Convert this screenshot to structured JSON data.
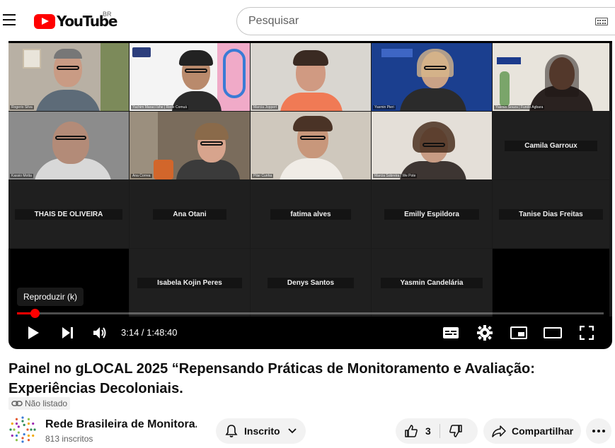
{
  "header": {
    "logo_text": "YouTube",
    "country_code": "BR",
    "search_placeholder": "Pesquisar"
  },
  "player": {
    "tooltip": "Reproduzir (k)",
    "time_current": "3:14",
    "time_total": "1:48:40",
    "time_display": "3:14 / 1:48:40",
    "progress_fraction": 0.0298,
    "video_tiles": [
      {
        "caption": "Rogerio Silva"
      },
      {
        "caption": "Yachim Maraci Ishe | Rede Comuá"
      },
      {
        "caption": "Marcia Joppert"
      },
      {
        "caption": "Yasmin Pieri"
      },
      {
        "caption": "Yasmin Souza | Fundo Agbara"
      },
      {
        "caption": "Kassio Motta"
      },
      {
        "caption": "Ana Correa"
      },
      {
        "caption": "Pilar Cunha"
      },
      {
        "caption": "Marcia Sobreira | We Pote"
      }
    ],
    "name_tiles": [
      "Camila Garroux",
      "THAIS DE OLIVEIRA",
      "Ana Otani",
      "fatima alves",
      "Emilly Espildora",
      "Tanise Dias Freitas",
      "Isabela Kojin Peres",
      "Denys Santos",
      "Yasmin Candelária"
    ]
  },
  "video": {
    "title": "Painel no gLOCAL 2025 “Repensando Práticas de Monitoramento e Avaliação: Experiências Decoloniais.",
    "visibility": "Não listado"
  },
  "channel": {
    "name": "Rede Brasileira de Monitora...",
    "subscribers": "813 inscritos",
    "subscribe_label": "Inscrito"
  },
  "actions": {
    "like_count": "3",
    "share_label": "Compartilhar"
  },
  "colors": {
    "accent": "#ff0000",
    "player_bg": "#000000"
  }
}
